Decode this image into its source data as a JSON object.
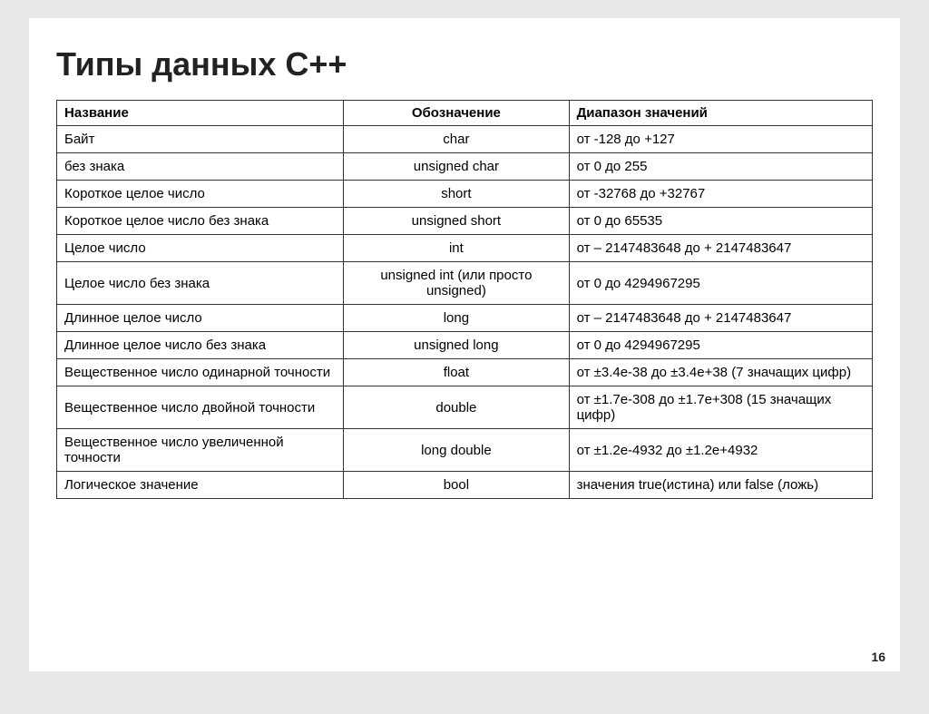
{
  "title": "Типы данных С++",
  "table": {
    "headers": [
      "Название",
      "Обозначение",
      "Диапазон значений"
    ],
    "rows": [
      {
        "name": "Байт",
        "notation": "char",
        "range": "от -128 до +127"
      },
      {
        "name": "без знака",
        "notation": "unsigned char",
        "range": "от 0 до 255"
      },
      {
        "name": "Короткое целое число",
        "notation": "short",
        "range": "от -32768 до +32767"
      },
      {
        "name": "Короткое целое число без знака",
        "notation": "unsigned short",
        "range": "от 0 до 65535"
      },
      {
        "name": "Целое число",
        "notation": "int",
        "range": "от – 2147483648 до + 2147483647"
      },
      {
        "name": "Целое число без знака",
        "notation": "unsigned int (или просто unsigned)",
        "range": "от 0 до 4294967295"
      },
      {
        "name": "Длинное целое число",
        "notation": "long",
        "range": "от – 2147483648 до + 2147483647"
      },
      {
        "name": "Длинное целое число без знака",
        "notation": "unsigned long",
        "range": "от 0 до 4294967295"
      },
      {
        "name": "Вещественное число одинарной точности",
        "notation": "float",
        "range": "от ±3.4е-38 до ±3.4е+38 (7 значащих цифр)"
      },
      {
        "name": "Вещественное число двойной точности",
        "notation": "double",
        "range": "от ±1.7е-308 до ±1.7е+308 (15 значащих цифр)"
      },
      {
        "name": "Вещественное число увеличенной точности",
        "notation": "long double",
        "range": "от ±1.2е-4932 до ±1.2е+4932"
      },
      {
        "name": "Логическое значение",
        "notation": "bool",
        "range": "значения true(истина) или false (ложь)"
      }
    ]
  },
  "page_number": "16"
}
